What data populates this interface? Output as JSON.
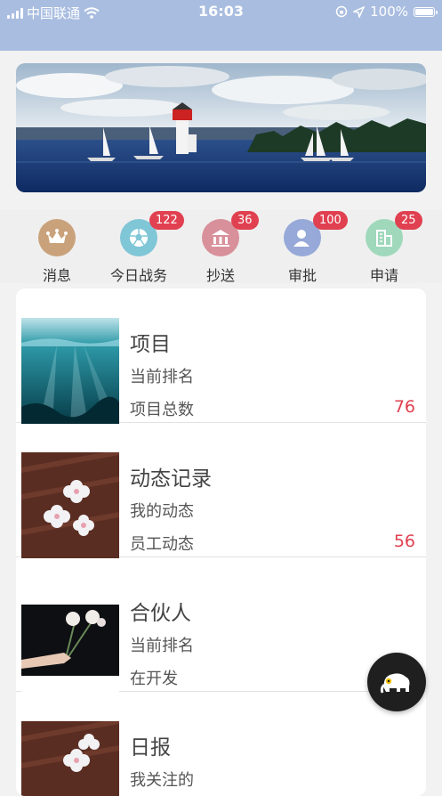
{
  "status_bar": {
    "carrier": "中国联通",
    "time": "16:03",
    "battery": "100%"
  },
  "icons": [
    {
      "label": "消息",
      "badge": "",
      "color": "#c9a27b",
      "icon": "crown-icon"
    },
    {
      "label": "今日战务",
      "badge": "122",
      "color": "#7fc6d6",
      "icon": "soccer-ball-icon"
    },
    {
      "label": "抄送",
      "badge": "36",
      "color": "#d8909a",
      "icon": "bank-icon"
    },
    {
      "label": "审批",
      "badge": "100",
      "color": "#96a9d8",
      "icon": "user-icon"
    },
    {
      "label": "申请",
      "badge": "25",
      "color": "#9fd8bb",
      "icon": "building-icon"
    }
  ],
  "rows": [
    {
      "title": "项目",
      "sub1": "当前排名",
      "sub2": "项目总数",
      "num": "76",
      "thumb": "underwater"
    },
    {
      "title": "动态记录",
      "sub1": "我的动态",
      "sub2": "员工动态",
      "num": "56",
      "thumb": "flowers-wood"
    },
    {
      "title": "合伙人",
      "sub1": "当前排名",
      "sub2": "在开发",
      "num": "",
      "thumb": "hand-flower"
    },
    {
      "title": "日报",
      "sub1": "我关注的",
      "sub2": "",
      "num": "",
      "thumb": "flowers-wood"
    }
  ],
  "colors": {
    "accent": "#e04050",
    "status_bar": "#a9bde0"
  },
  "fab": {
    "icon": "elephant-icon"
  }
}
